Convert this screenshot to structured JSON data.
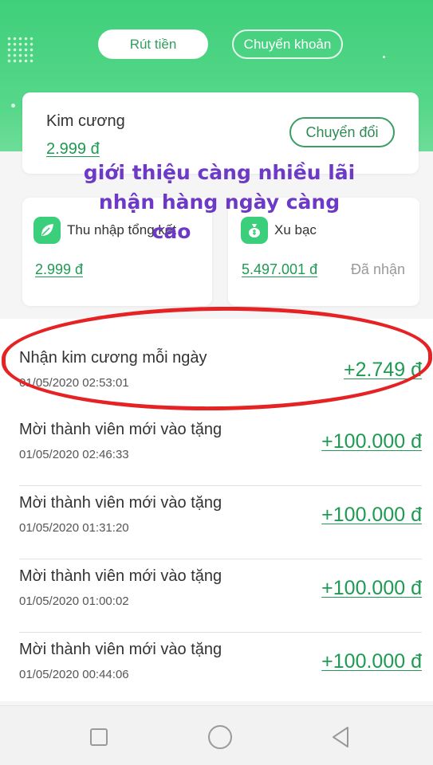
{
  "tabs": {
    "withdraw": "Rút tiền",
    "transfer": "Chuyển khoản"
  },
  "main_card": {
    "label": "Kim cương",
    "amount": "2.999 đ",
    "convert_button": "Chuyển đổi"
  },
  "income_card": {
    "icon": "leaf-icon",
    "title": "Thu nhập tổng kết",
    "value": "2.999 đ"
  },
  "silver_card": {
    "icon": "money-bag-icon",
    "title": "Xu bạc",
    "value": "5.497.001 đ",
    "status": "Đã nhận"
  },
  "overlay_text": {
    "line1": "giới thiệu càng nhiều lãi",
    "line2": "nhận hàng ngày càng",
    "line3": "cao"
  },
  "transactions": [
    {
      "title": "Nhận kim cương mỗi ngày",
      "time": "01/05/2020 02:53:01",
      "amount": "+2.749 đ"
    },
    {
      "title": "Mời thành viên mới vào tặng",
      "time": "01/05/2020 02:46:33",
      "amount": "+100.000 đ"
    },
    {
      "title": "Mời thành viên mới vào tặng",
      "time": "01/05/2020 01:31:20",
      "amount": "+100.000 đ"
    },
    {
      "title": "Mời thành viên mới vào tặng",
      "time": "01/05/2020 01:00:02",
      "amount": "+100.000 đ"
    },
    {
      "title": "Mời thành viên mới vào tặng",
      "time": "01/05/2020 00:44:06",
      "amount": "+100.000 đ"
    }
  ],
  "colors": {
    "brand_green": "#3fcf7a",
    "amount_green": "#1f9a52",
    "annotation_red": "#e52324",
    "overlay_purple": "#6c3ac7"
  }
}
